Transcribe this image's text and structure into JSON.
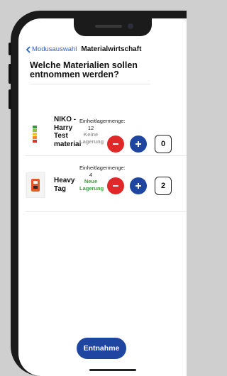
{
  "nav": {
    "back_label": "Modusauswahl",
    "title": "Materialwirtschaft"
  },
  "question": "Welche Materialien sollen entnommen werden?",
  "items": [
    {
      "name": "NIKO - Harry Test material",
      "unit_label": "Einheitlagermenge:",
      "unit_value": "12",
      "status": "Keine Lagerung",
      "status_color": "#9a9a9a",
      "quantity": "0",
      "thumb_icon": "battery-level-indicator-icon"
    },
    {
      "name": "Heavy Tag",
      "unit_label": "Einheitlagermenge:",
      "unit_value": "4",
      "status": "Neue Lagerung",
      "status_color": "#3aa040",
      "quantity": "2",
      "thumb_icon": "tag-device-icon"
    }
  ],
  "colors": {
    "minus": "#e02828",
    "plus": "#1e46a0",
    "primary": "#1e46a0"
  },
  "footer": {
    "button_label": "Entnahme"
  }
}
